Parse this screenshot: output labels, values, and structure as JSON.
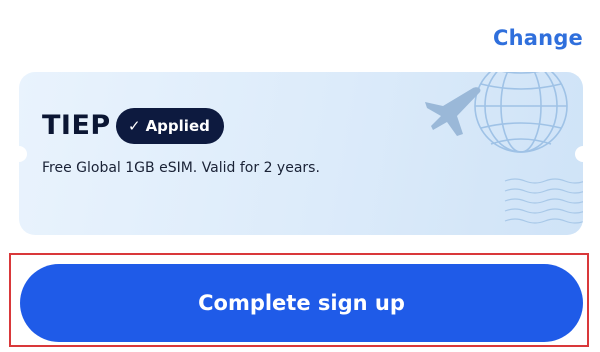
{
  "header": {
    "change_label": "Change"
  },
  "promo": {
    "code": "TIEP",
    "badge_label": "Applied",
    "description": "Free Global 1GB eSIM. Valid for 2 years."
  },
  "cta": {
    "label": "Complete sign up"
  },
  "colors": {
    "accent": "#2f6fdc",
    "button": "#1f5be8",
    "badge": "#0d1a3f",
    "highlight_border": "#d9383a",
    "card_bg": "#e3effb"
  },
  "icons": {
    "badge_check": "check-icon",
    "illustration_globe": "globe-icon",
    "illustration_plane": "airplane-icon"
  }
}
